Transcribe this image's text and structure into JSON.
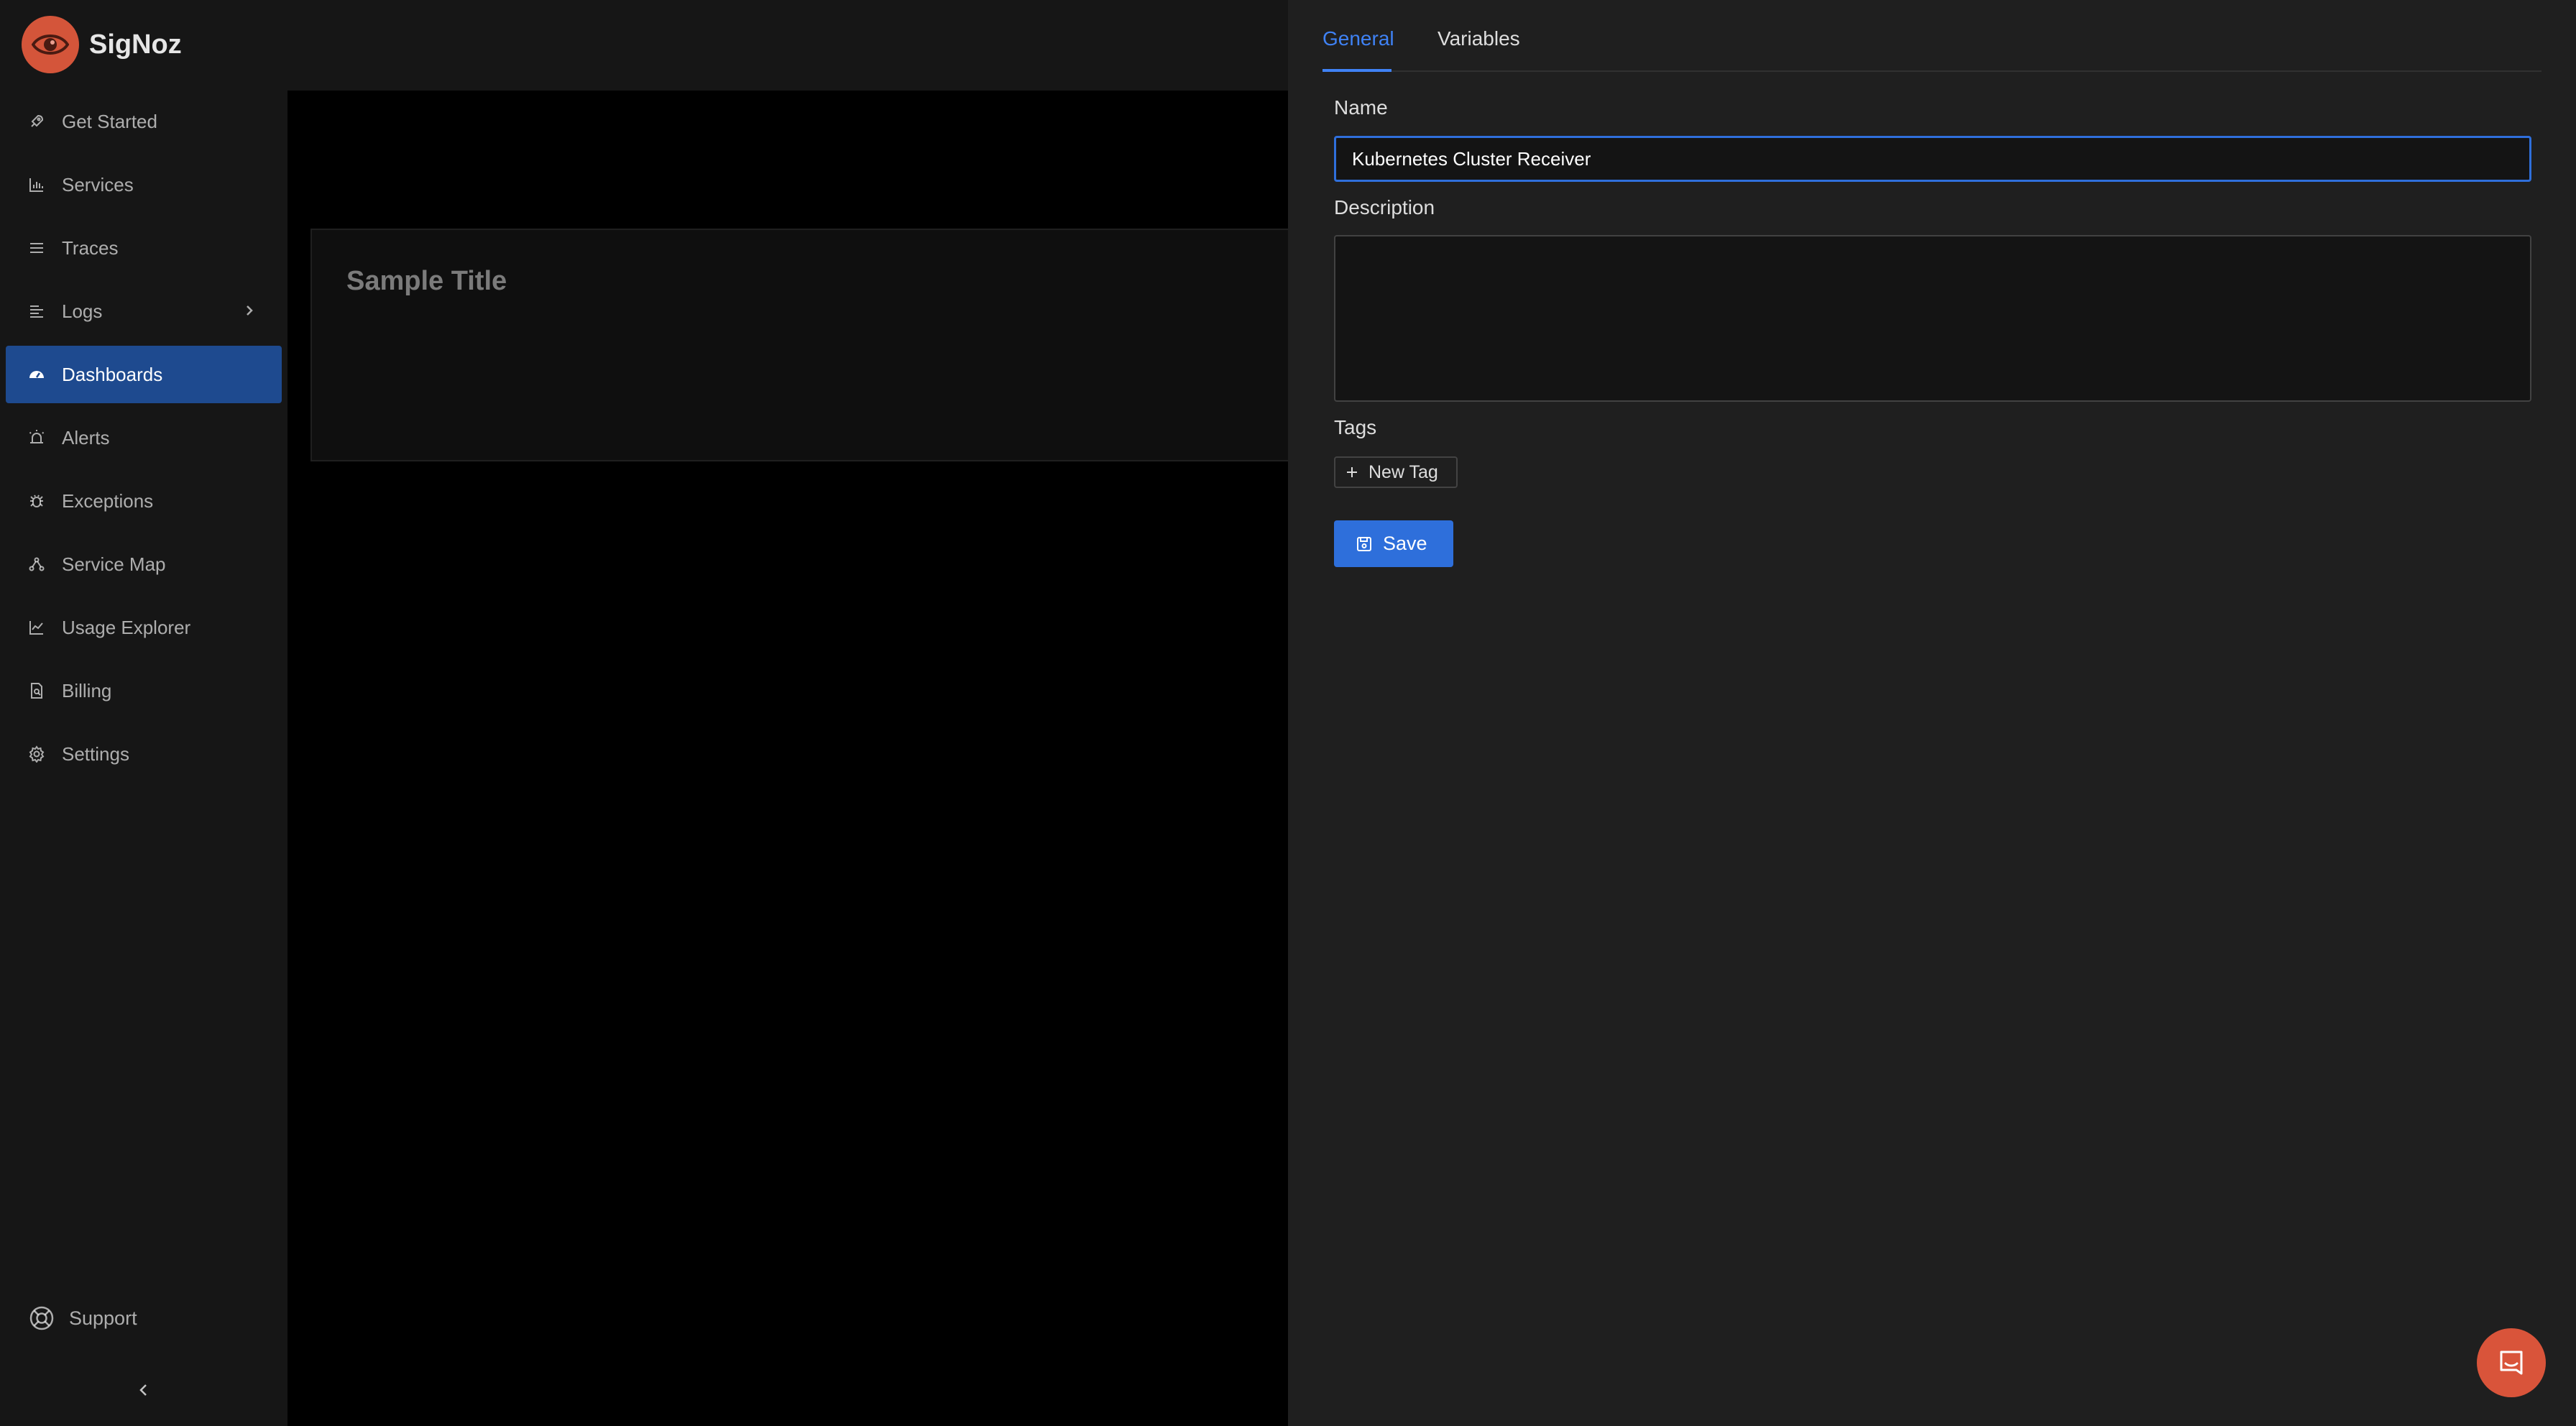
{
  "app": {
    "name": "SigNoz"
  },
  "sidebar": {
    "items": [
      {
        "label": "Get Started",
        "icon": "rocket-icon"
      },
      {
        "label": "Services",
        "icon": "bar-chart-icon"
      },
      {
        "label": "Traces",
        "icon": "list-icon"
      },
      {
        "label": "Logs",
        "icon": "align-left-icon"
      },
      {
        "label": "Dashboards",
        "icon": "dashboard-icon",
        "active": true
      },
      {
        "label": "Alerts",
        "icon": "alarm-icon"
      },
      {
        "label": "Exceptions",
        "icon": "bug-icon"
      },
      {
        "label": "Service Map",
        "icon": "deployment-icon"
      },
      {
        "label": "Usage Explorer",
        "icon": "line-chart-icon"
      },
      {
        "label": "Billing",
        "icon": "file-search-icon"
      },
      {
        "label": "Settings",
        "icon": "gear-icon"
      }
    ],
    "support_label": "Support"
  },
  "main": {
    "widget_title": "Sample Title"
  },
  "drawer": {
    "tabs": [
      {
        "label": "General",
        "active": true
      },
      {
        "label": "Variables",
        "active": false
      }
    ],
    "name_label": "Name",
    "name_value": "Kubernetes Cluster Receiver",
    "description_label": "Description",
    "description_value": "",
    "tags_label": "Tags",
    "new_tag_label": "New Tag",
    "save_label": "Save"
  },
  "colors": {
    "accent": "#3f82f5",
    "active_nav": "#1e4a8f",
    "brand": "#d4553a"
  }
}
